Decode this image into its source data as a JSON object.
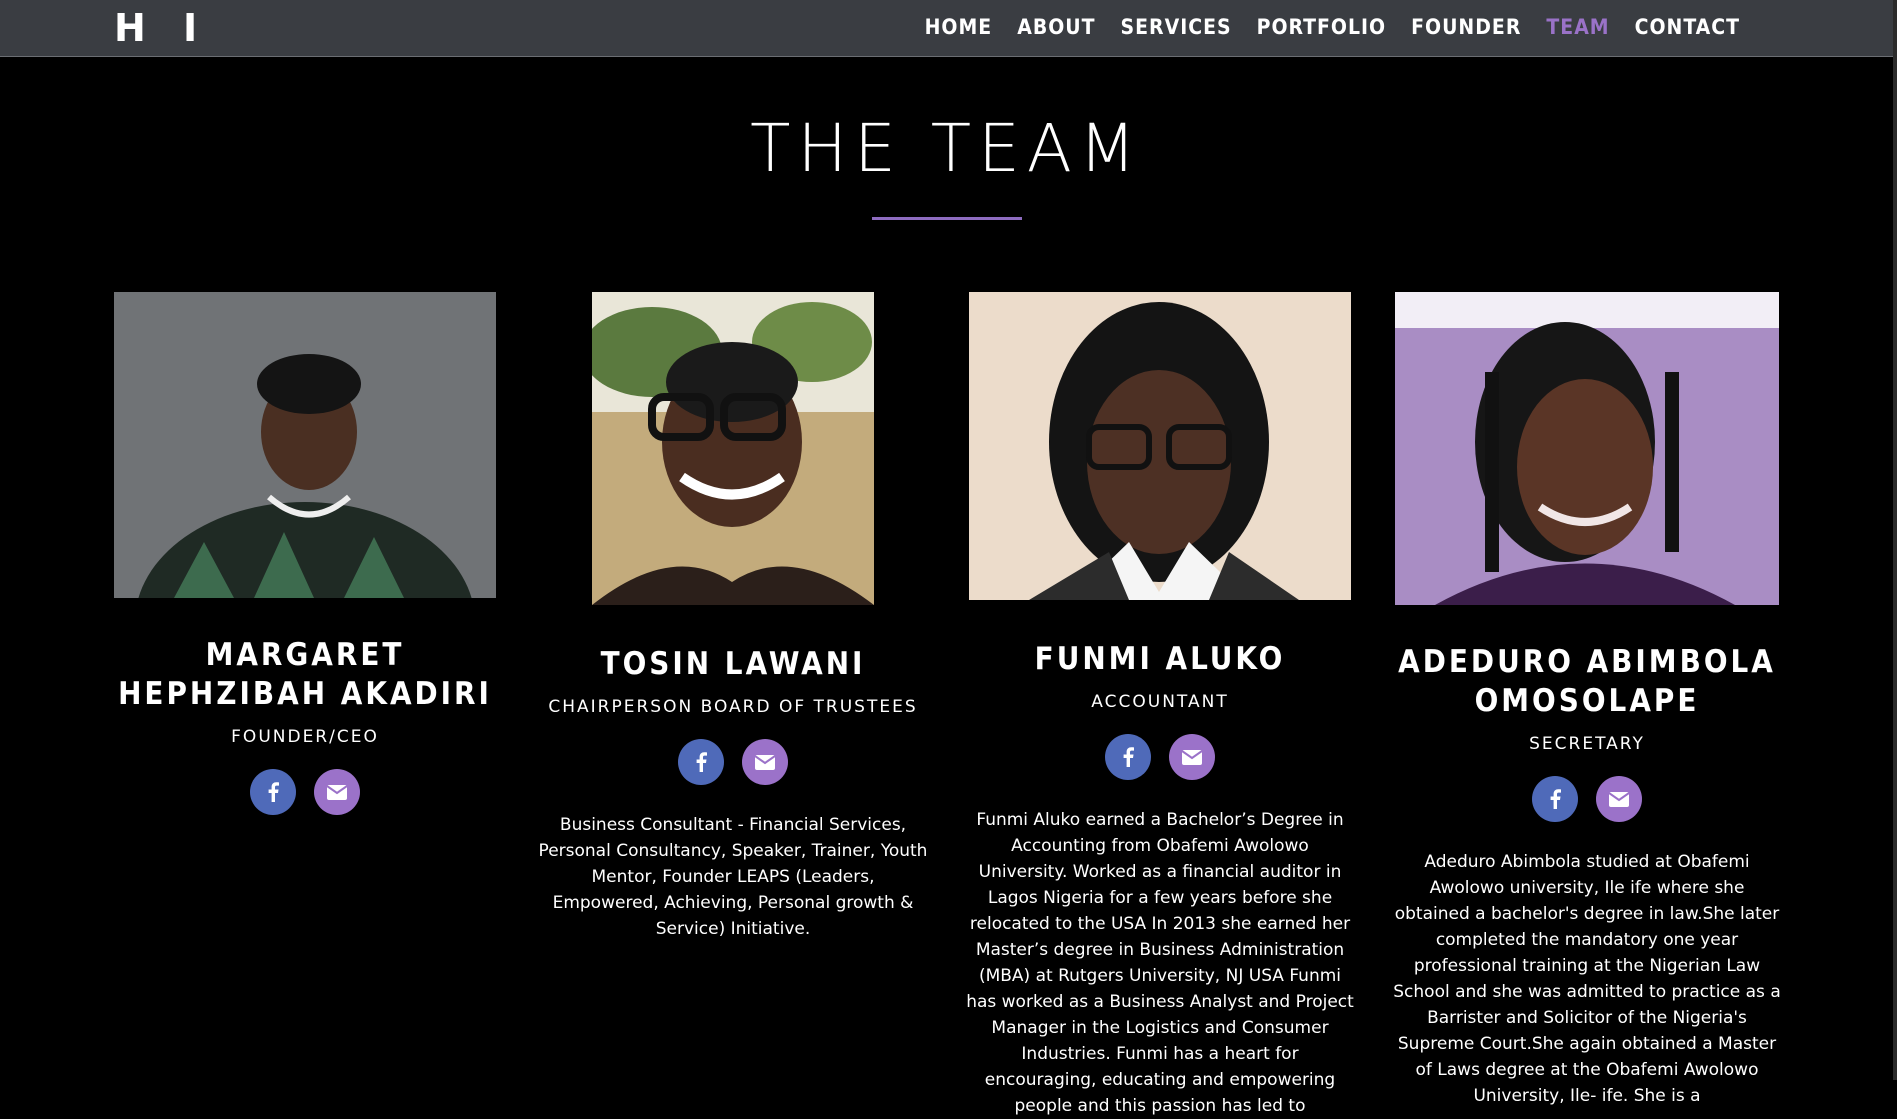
{
  "nav": {
    "logo": "H I",
    "links": [
      {
        "label": "HOME"
      },
      {
        "label": "ABOUT"
      },
      {
        "label": "SERVICES"
      },
      {
        "label": "PORTFOLIO"
      },
      {
        "label": "FOUNDER"
      },
      {
        "label": "TEAM",
        "active": true
      },
      {
        "label": "CONTACT"
      }
    ],
    "active_color": "#9a72c8"
  },
  "section": {
    "title": "THE TEAM",
    "underline_color": "#8e6cc0"
  },
  "team": [
    {
      "name": "MARGARET HEPHZIBAH AKADIRI",
      "role": "FOUNDER/CEO",
      "bio": "",
      "photo_bg": "#6f7275"
    },
    {
      "name": "TOSIN LAWANI",
      "role": "CHAIRPERSON BOARD OF TRUSTEES",
      "bio": "Business Consultant - Financial Services, Personal Consultancy, Speaker, Trainer, Youth Mentor, Founder LEAPS (Leaders, Empowered, Achieving, Personal growth & Service) Initiative.",
      "photo_bg": "#c9b48a"
    },
    {
      "name": "FUNMI ALUKO",
      "role": "ACCOUNTANT",
      "bio": "Funmi Aluko earned a Bachelor’s Degree in Accounting from Obafemi Awolowo University. Worked as a financial auditor in Lagos Nigeria for a few years before she relocated to the USA In 2013 she earned her Master’s degree in Business Administration (MBA) at Rutgers University, NJ USA Funmi has worked as a Business Analyst and Project Manager in the Logistics and Consumer Industries. Funmi has a heart for encouraging, educating and empowering people and this passion has led to",
      "photo_bg": "#e9d7c4"
    },
    {
      "name": "ADEDURO ABIMBOLA OMOSOLAPE",
      "role": "SECRETARY",
      "bio": "Adeduro Abimbola studied at Obafemi Awolowo university, Ile ife where she obtained a bachelor's degree in law.She later completed the mandatory one year professional training at the Nigerian Law School and she was admitted to practice as a Barrister and Solicitor of the Nigeria's Supreme Court.She again obtained a Master of Laws degree at the Obafemi Awolowo University, Ile- ife. She is a",
      "photo_bg": "#a58bc0"
    }
  ],
  "social_colors": {
    "facebook": "#4f6ab9",
    "email": "#9b72c9"
  },
  "icons": {
    "facebook": "facebook-icon",
    "email": "envelope-icon"
  }
}
